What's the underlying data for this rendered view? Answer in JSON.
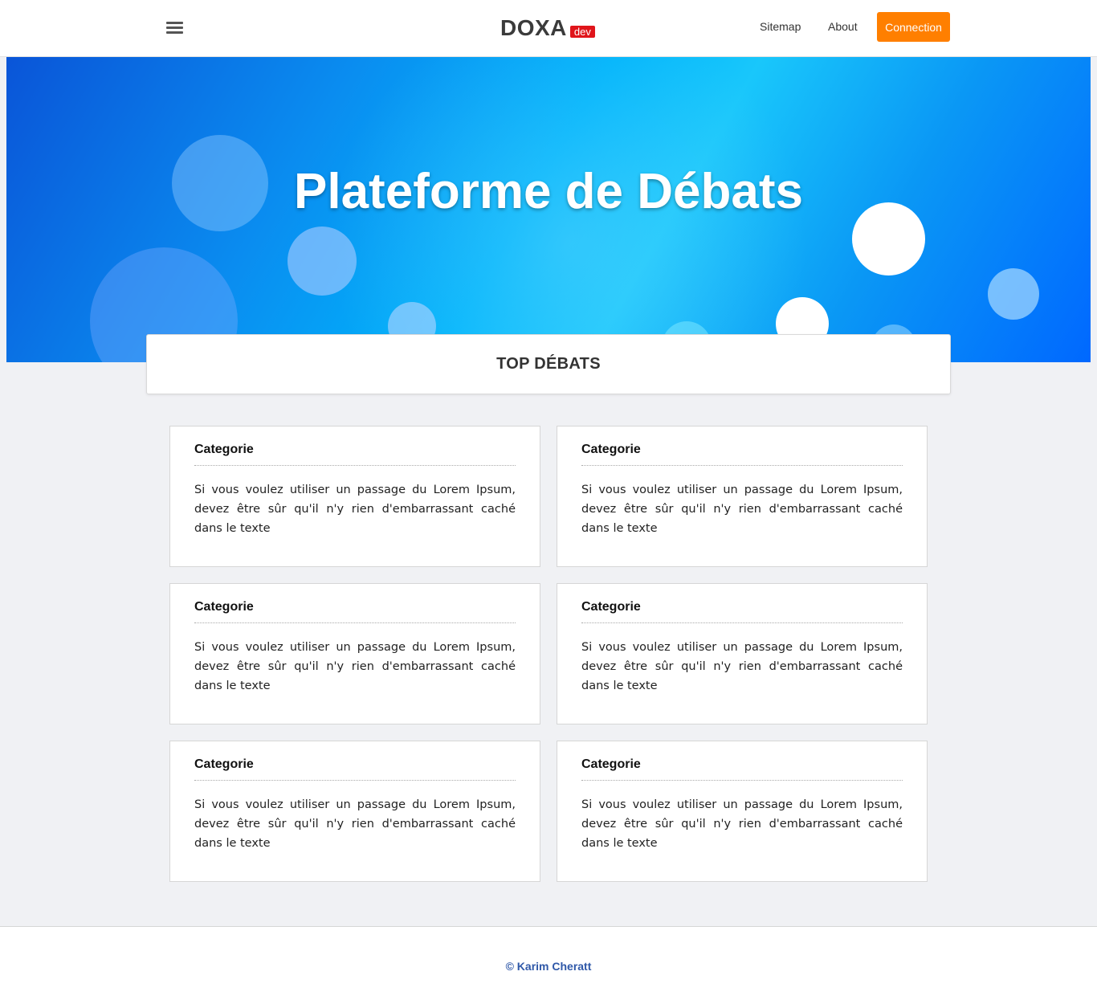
{
  "header": {
    "brand": "DOXA",
    "badge": "dev",
    "nav": {
      "sitemap": "Sitemap",
      "about": "About",
      "connection": "Connection"
    }
  },
  "hero": {
    "title": "Plateforme de Débats"
  },
  "top_debates": {
    "heading": "TOP DÉBATS"
  },
  "cards": [
    {
      "title": "Categorie",
      "text": "Si vous voulez utiliser un passage du Lorem Ipsum, devez être sûr qu'il n'y rien d'embarrassant caché dans le texte"
    },
    {
      "title": "Categorie",
      "text": "Si vous voulez utiliser un passage du Lorem Ipsum, devez être sûr qu'il n'y rien d'embarrassant caché dans le texte"
    },
    {
      "title": "Categorie",
      "text": "Si vous voulez utiliser un passage du Lorem Ipsum, devez être sûr qu'il n'y rien d'embarrassant caché dans le texte"
    },
    {
      "title": "Categorie",
      "text": "Si vous voulez utiliser un passage du Lorem Ipsum, devez être sûr qu'il n'y rien d'embarrassant caché dans le texte"
    },
    {
      "title": "Categorie",
      "text": "Si vous voulez utiliser un passage du Lorem Ipsum, devez être sûr qu'il n'y rien d'embarrassant caché dans le texte"
    },
    {
      "title": "Categorie",
      "text": "Si vous voulez utiliser un passage du Lorem Ipsum, devez être sûr qu'il n'y rien d'embarrassant caché dans le texte"
    }
  ],
  "footer": {
    "copyright": "© Karim Cheratt"
  },
  "colors": {
    "accent": "#ff7f00",
    "badge": "#e0151b",
    "footer_text": "#2f58a8"
  },
  "icons": {
    "menu": "hamburger-menu-icon"
  }
}
